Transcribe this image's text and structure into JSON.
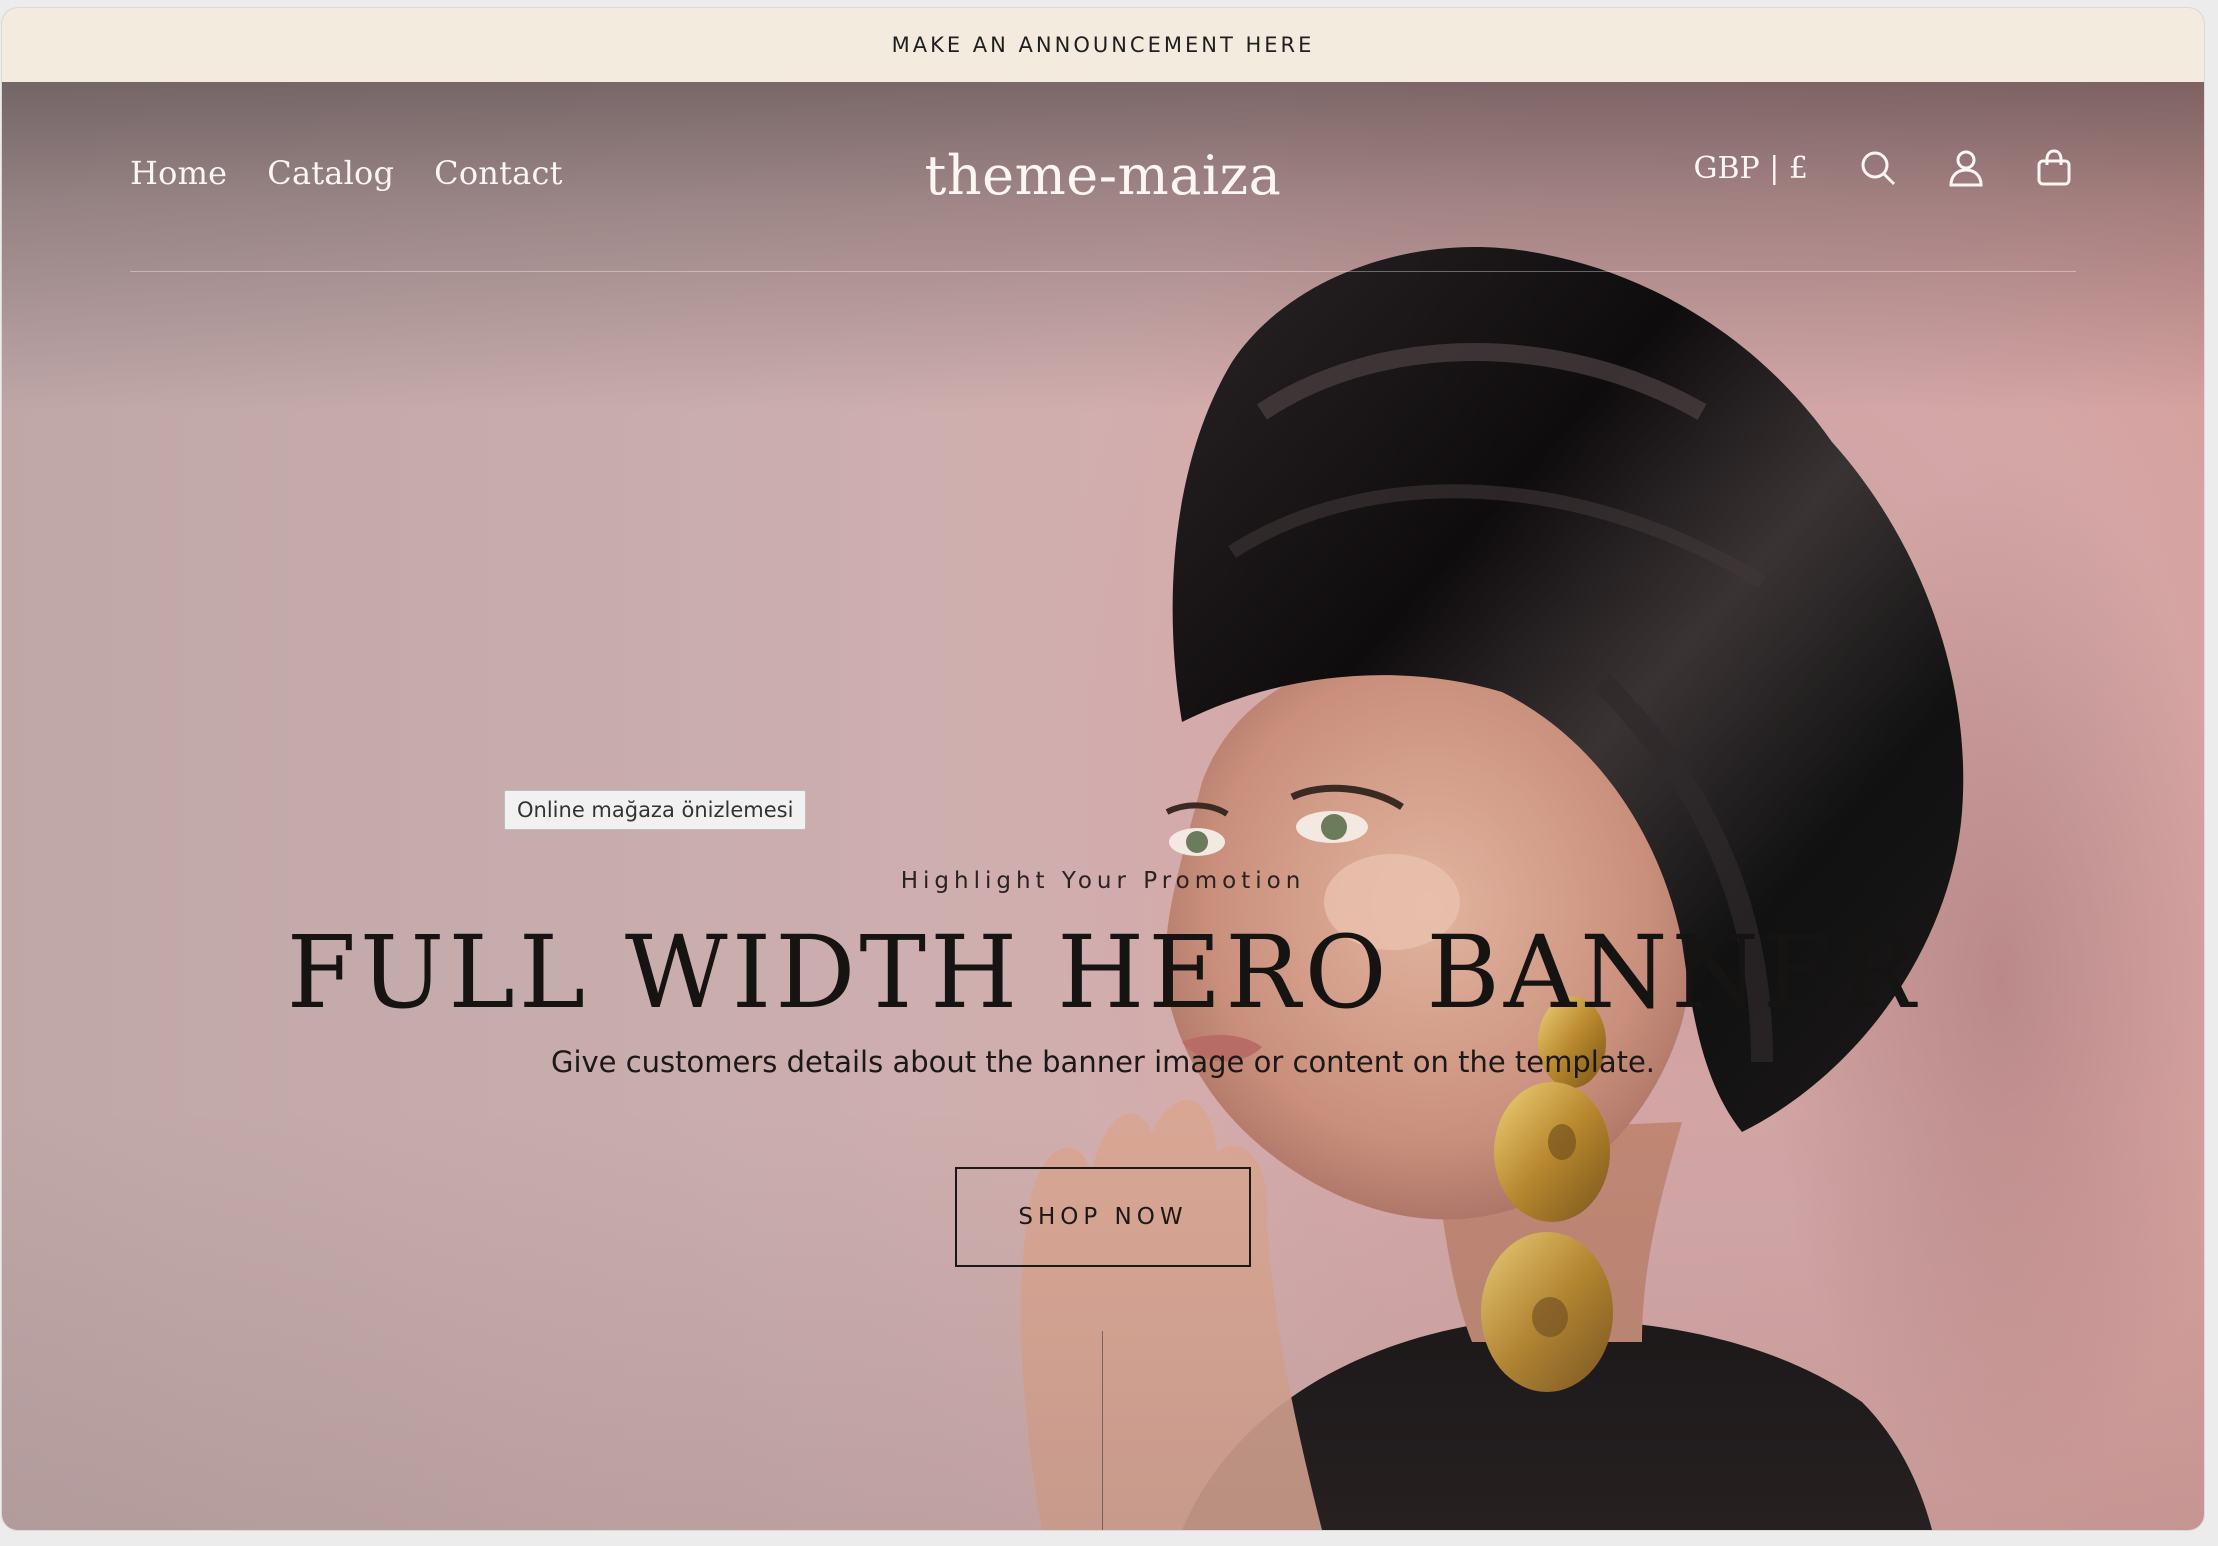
{
  "announcement": {
    "text": "MAKE AN ANNOUNCEMENT HERE"
  },
  "header": {
    "nav": [
      {
        "label": "Home"
      },
      {
        "label": "Catalog"
      },
      {
        "label": "Contact"
      }
    ],
    "logo": "theme-maiza",
    "currency": "GBP | £",
    "icons": [
      "search-icon",
      "account-icon",
      "cart-icon"
    ]
  },
  "tooltip": {
    "text": "Online mağaza önizlemesi"
  },
  "hero": {
    "subheading": "Highlight Your Promotion",
    "headline": "FULL WIDTH HERO BANNER",
    "description": "Give customers details about the banner image or content on the template.",
    "cta_label": "SHOP NOW"
  },
  "colors": {
    "announcement_bg": "#f4ebdf",
    "hero_bg": "#d4aeae",
    "header_text": "#fbf6f1",
    "body_text": "#161313"
  }
}
